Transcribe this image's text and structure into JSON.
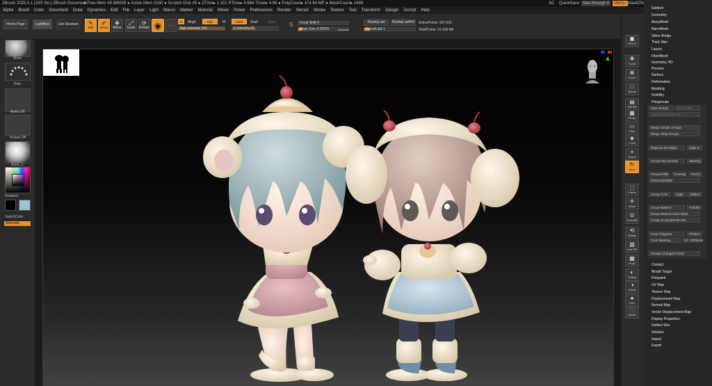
{
  "titlebar": {
    "title": "ZBrush 2025.0.1 [23® No.] ZBrush Document",
    "stats": "● Free Mem 49.889GB ● Active Mem 3160 ● Scratch Disk 45 ● ZTime▸ 1.151 RTime▸ 4.664 Timer▸ 4.56 ● PolyCount▸ 474.64 MP ● MeshCount▸ 2489",
    "ac": "AC",
    "quicksave": "QuickSave",
    "seethrough": "See-through",
    "seethrough_value": "0",
    "menus_btn": "Menus",
    "defaultzscript": "DefaultZScript"
  },
  "menubar": [
    "Alpha",
    "Brush",
    "Color",
    "Document",
    "Draw",
    "Dynamics",
    "Edit",
    "File",
    "Layer",
    "Light",
    "Macro",
    "Marker",
    "Material",
    "Movie",
    "Picker",
    "Preferences",
    "Render",
    "Stencil",
    "Stroke",
    "Texture",
    "Tool",
    "Transform",
    "Zplugin",
    "Zscript",
    "Help"
  ],
  "toolbar": {
    "home_page": "Home Page",
    "lightbox": "LightBox",
    "live_boolean": "Live Boolean",
    "edit": "Edit",
    "draw": "Draw",
    "move": "Move",
    "scale": "Scale",
    "rotate": "Rotate",
    "a": "A",
    "mrgb": "Mrgb",
    "rgb": "Rgb",
    "m": "M",
    "zadd": "Zadd",
    "zsub": "Zsub",
    "zcut": "Zcut",
    "rgb_intensity": "Rgb Intensity 100",
    "z_intensity": "Z Intensity 51",
    "focal_shift": "Focal Shift 0",
    "draw_size": "Draw Size 4.99256",
    "dynamic": "Dynamic",
    "replaylast": "ReplayLast",
    "replaylastrel": "ReplayLastRel",
    "adjustlast": "AdjustLast 1",
    "activepoints": "ActivePoints: 667,811",
    "totalpoints": "TotalPoints: 21.599 Mil"
  },
  "left_shelf": {
    "move": "Move",
    "dots": "Dots",
    "alpha_off": "Alpha Off",
    "texture_off": "Texture Off",
    "material": "Basic_1",
    "gradient": "Gradient",
    "switchcolor": "SwitchColor",
    "alternate": "Alternate"
  },
  "right_shelf": [
    {
      "name": "spix",
      "label": "SPix 3",
      "glyph": "▣"
    },
    {
      "name": "scroll",
      "label": "Scroll",
      "glyph": "✥"
    },
    {
      "name": "zoom",
      "label": "Zoom",
      "glyph": "⊕"
    },
    {
      "name": "actual",
      "label": "Actual",
      "glyph": "□"
    },
    {
      "name": "aahalf",
      "label": "AAHalf",
      "glyph": "▤"
    },
    {
      "name": "persp",
      "label": "Persp",
      "glyph": "▦"
    },
    {
      "name": "floor",
      "label": "Floor",
      "glyph": "▭"
    },
    {
      "name": "local",
      "label": "Local",
      "glyph": "◈"
    },
    {
      "name": "gizmo",
      "label": "Gizmo",
      "glyph": "⌖"
    },
    {
      "name": "xyz",
      "label": "Qxyz",
      "glyph": "↻"
    },
    {
      "name": "frame",
      "label": "Frame",
      "glyph": "⬚"
    },
    {
      "name": "move",
      "label": "Move",
      "glyph": "✛"
    },
    {
      "name": "zoom3d",
      "label": "Zoom3D",
      "glyph": "⊙"
    },
    {
      "name": "rotate",
      "label": "Rotate",
      "glyph": "⟲"
    },
    {
      "name": "linefill",
      "label": "Line Fill",
      "glyph": "▧"
    },
    {
      "name": "polyf",
      "label": "PolyF",
      "glyph": "▩"
    },
    {
      "name": "transp",
      "label": "Transp",
      "glyph": "◐"
    },
    {
      "name": "ghost",
      "label": "Ghost",
      "glyph": "◑"
    },
    {
      "name": "solo",
      "label": "Solo",
      "glyph": "●"
    },
    {
      "name": "xpose",
      "label": "Xpose",
      "glyph": "⬛"
    }
  ],
  "tray": {
    "sections_top": [
      "Subtool",
      "Geometry",
      "ArrayMesh",
      "NanoMesh",
      "Thick Skin",
      "Layers",
      "FiberMesh",
      "Geometry HD",
      "Preview",
      "Surface",
      "Deformation",
      "Masking",
      "Visibility",
      "Polygroups"
    ],
    "slime_bridge": "Slime Bridge",
    "polygroups": {
      "auto_groups": "Auto Groups",
      "uv_groups": "Uv Groups",
      "auto_groups_uv": "Auto Groups With UV",
      "merge_similar": "Merge Similar Groups",
      "merge_stray": "Merge Stray Groups",
      "regroup_edges": "Regroup By Edges",
      "edge_d": "Edge D",
      "groups_normals": "Groups By Normals",
      "maxdeg": "MaxDeg",
      "group_visible": "GroupVisible",
      "coverage": "Coverag",
      "clust": "Clust 0",
      "regroup_visible": "ReGroupVisible",
      "group_front": "Group Front",
      "angle": "Angle",
      "additive": "Additive",
      "group_masked": "Group Masked",
      "polish": "PolishB",
      "group_masked_clear": "Group Masked Clear Mask",
      "group_dynamesh": "Group As Dynamesh Sub",
      "from_polypaint": "From Polypaint",
      "tolerance": "PTolera",
      "from_masking": "From Masking",
      "cmin": "Cm",
      "mtolerance": "MToleran",
      "groups_changed": "Groups Changed Points"
    },
    "sections_bottom": [
      "Contact",
      "Morph Target",
      "Polypaint",
      "UV Map",
      "Texture Map",
      "Displacement Map",
      "Normal Map",
      "Vector Displacement Map",
      "Display Properties",
      "Unified Skin",
      "Initialize",
      "Import",
      "Export"
    ]
  },
  "colors": {
    "accent": "#e8902a",
    "viewport_bg": "#000000",
    "panel": "#2b2b2b"
  }
}
